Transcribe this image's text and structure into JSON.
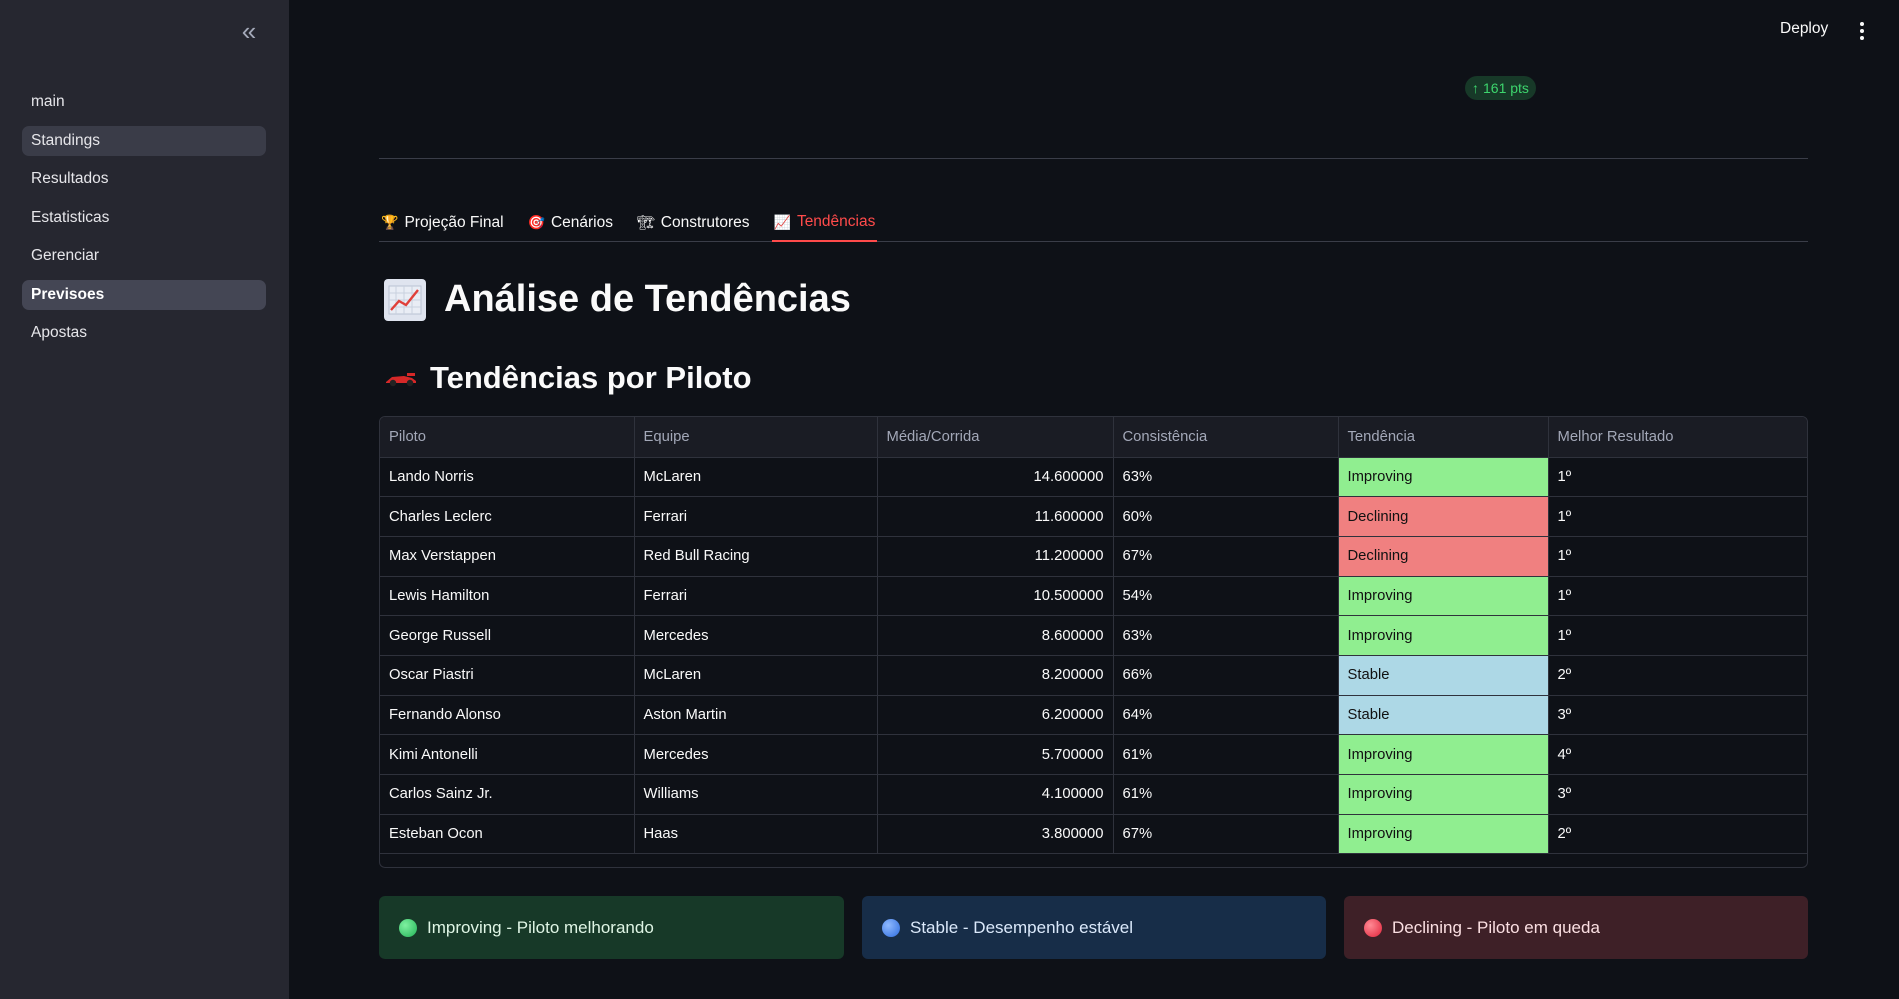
{
  "sidebar": {
    "collapse_glyph": "«",
    "items": [
      {
        "label": "main",
        "state": "normal"
      },
      {
        "label": "Standings",
        "state": "highlighted"
      },
      {
        "label": "Resultados",
        "state": "normal"
      },
      {
        "label": "Estatisticas",
        "state": "normal"
      },
      {
        "label": "Gerenciar",
        "state": "normal"
      },
      {
        "label": "Previsoes",
        "state": "active"
      },
      {
        "label": "Apostas",
        "state": "normal"
      }
    ]
  },
  "header": {
    "deploy_label": "Deploy",
    "menu_icon": "vertical-ellipsis-icon"
  },
  "metric": {
    "delta_arrow": "↑",
    "delta_text": "161 pts",
    "color": "#3dd56d"
  },
  "tabs": [
    {
      "icon": "🏆",
      "label": "Projeção Final",
      "active": false
    },
    {
      "icon": "🎯",
      "label": "Cenários",
      "active": false
    },
    {
      "icon": "🏗",
      "label": "Construtores",
      "active": false
    },
    {
      "icon": "📈",
      "label": "Tendências",
      "active": true
    }
  ],
  "page_title": {
    "icon": "📈",
    "text": "Análise de Tendências"
  },
  "section_title": {
    "icon": "race-car-icon",
    "text": "Tendências por Piloto"
  },
  "table": {
    "columns": [
      "Piloto",
      "Equipe",
      "Média/Corrida",
      "Consistência",
      "Tendência",
      "Melhor Resultado"
    ],
    "rows": [
      [
        "Lando Norris",
        "McLaren",
        "14.600000",
        "63%",
        "Improving",
        "1º"
      ],
      [
        "Charles Leclerc",
        "Ferrari",
        "11.600000",
        "60%",
        "Declining",
        "1º"
      ],
      [
        "Max Verstappen",
        "Red Bull Racing",
        "11.200000",
        "67%",
        "Declining",
        "1º"
      ],
      [
        "Lewis Hamilton",
        "Ferrari",
        "10.500000",
        "54%",
        "Improving",
        "1º"
      ],
      [
        "George Russell",
        "Mercedes",
        "8.600000",
        "63%",
        "Improving",
        "1º"
      ],
      [
        "Oscar Piastri",
        "McLaren",
        "8.200000",
        "66%",
        "Stable",
        "2º"
      ],
      [
        "Fernando Alonso",
        "Aston Martin",
        "6.200000",
        "64%",
        "Stable",
        "3º"
      ],
      [
        "Kimi Antonelli",
        "Mercedes",
        "5.700000",
        "61%",
        "Improving",
        "4º"
      ],
      [
        "Carlos Sainz Jr.",
        "Williams",
        "4.100000",
        "61%",
        "Improving",
        "3º"
      ],
      [
        "Esteban Ocon",
        "Haas",
        "3.800000",
        "67%",
        "Improving",
        "2º"
      ]
    ],
    "trend_colors": {
      "Improving": "#90ee90",
      "Declining": "#f08080",
      "Stable": "#add8e6"
    }
  },
  "legend": [
    {
      "text": "Improving - Piloto melhorando",
      "color": "#3dd56d"
    },
    {
      "text": "Stable - Desempenho estável",
      "color": "#3b82f6"
    },
    {
      "text": "Declining - Piloto em queda",
      "color": "#ef4444"
    }
  ]
}
